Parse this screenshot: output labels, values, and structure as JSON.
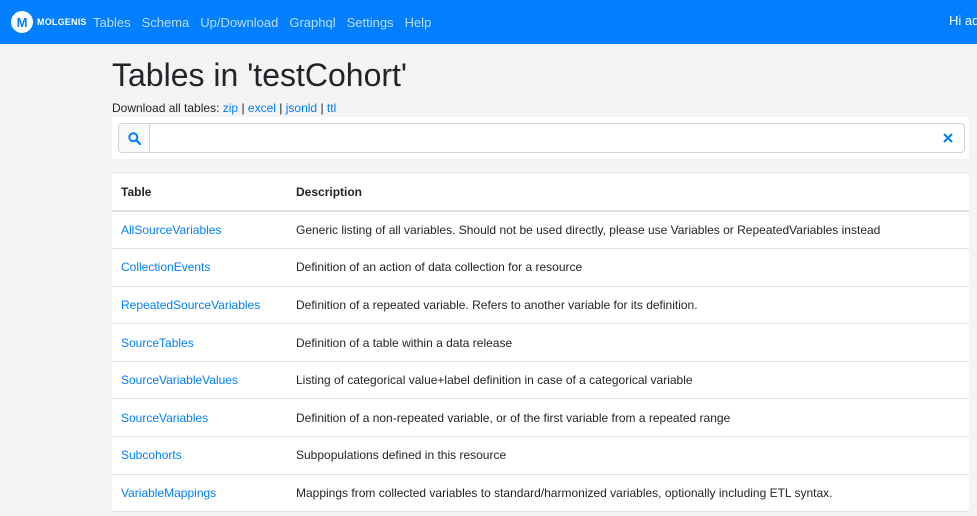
{
  "navbar": {
    "brand": "MOLGENIS",
    "items": [
      "Tables",
      "Schema",
      "Up/Download",
      "Graphql",
      "Settings",
      "Help"
    ],
    "user": "Hi ad"
  },
  "page": {
    "title": "Tables in 'testCohort'",
    "download_prefix": "Download all tables:",
    "download_links": [
      "zip",
      "excel",
      "jsonld",
      "ttl"
    ],
    "separator": "|"
  },
  "search": {
    "value": "",
    "placeholder": ""
  },
  "table": {
    "headers": {
      "name": "Table",
      "description": "Description"
    },
    "rows": [
      {
        "name": "AllSourceVariables",
        "description": "Generic listing of all variables. Should not be used directly, please use Variables or RepeatedVariables instead"
      },
      {
        "name": "CollectionEvents",
        "description": "Definition of an action of data collection for a resource"
      },
      {
        "name": "RepeatedSourceVariables",
        "description": "Definition of a repeated variable. Refers to another variable for its definition."
      },
      {
        "name": "SourceTables",
        "description": "Definition of a table within a data release"
      },
      {
        "name": "SourceVariableValues",
        "description": "Listing of categorical value+label definition in case of a categorical variable"
      },
      {
        "name": "SourceVariables",
        "description": "Definition of a non-repeated variable, or of the first variable from a repeated range"
      },
      {
        "name": "Subcohorts",
        "description": "Subpopulations defined in this resource"
      },
      {
        "name": "VariableMappings",
        "description": "Mappings from collected variables to standard/harmonized variables, optionally including ETL syntax."
      }
    ]
  },
  "colors": {
    "primary": "#017ffd",
    "background": "#f4f4f4"
  },
  "icons": {
    "logo": "molgenis-logo-icon",
    "search": "search-icon",
    "clear": "close-icon"
  }
}
